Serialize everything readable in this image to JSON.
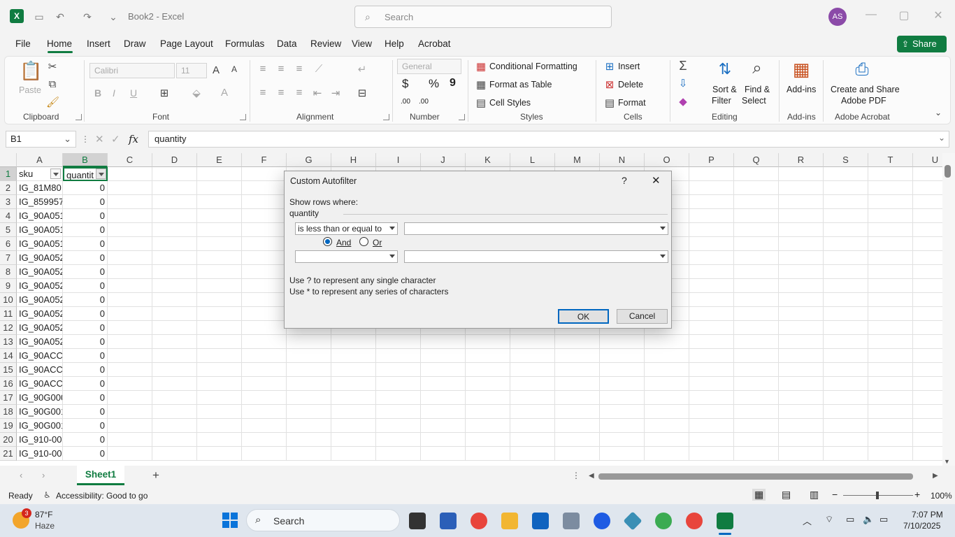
{
  "window": {
    "title": "Book2  -  Excel",
    "search_placeholder": "Search",
    "avatar_initials": "AS"
  },
  "menu": {
    "tabs": [
      "File",
      "Home",
      "Insert",
      "Draw",
      "Page Layout",
      "Formulas",
      "Data",
      "Review",
      "View",
      "Help",
      "Acrobat"
    ],
    "active": "Home",
    "share_label": "Share"
  },
  "ribbon": {
    "clipboard": {
      "paste": "Paste",
      "label": "Clipboard"
    },
    "font": {
      "name": "Calibri",
      "size": "11",
      "label": "Font",
      "bold": "B",
      "italic": "I",
      "underline": "U"
    },
    "alignment": {
      "label": "Alignment"
    },
    "number": {
      "format": "General",
      "label": "Number",
      "currency": "$",
      "percent": "%",
      "comma": "9",
      "inc_decimal": ".00",
      "dec_decimal": ".00"
    },
    "styles": {
      "conditional": "Conditional Formatting",
      "format_table": "Format as Table",
      "cell_styles": "Cell Styles",
      "label": "Styles"
    },
    "cells": {
      "insert": "Insert",
      "delete": "Delete",
      "format": "Format",
      "label": "Cells"
    },
    "editing": {
      "sort_filter_1": "Sort &",
      "sort_filter_2": "Filter",
      "find_select_1": "Find &",
      "find_select_2": "Select",
      "label": "Editing"
    },
    "addins": {
      "button": "Add-ins",
      "label": "Add-ins"
    },
    "acrobat": {
      "line1": "Create and Share",
      "line2": "Adobe PDF",
      "label": "Adobe Acrobat"
    }
  },
  "formula_bar": {
    "name_box": "B1",
    "fx": "fx",
    "content": "quantity"
  },
  "grid": {
    "columns": [
      "A",
      "B",
      "C",
      "D",
      "E",
      "F",
      "G",
      "H",
      "I",
      "J",
      "K",
      "L",
      "M",
      "N",
      "O",
      "P",
      "Q",
      "R",
      "S",
      "T",
      "U"
    ],
    "header_row": {
      "a": "sku",
      "b": "quantit"
    },
    "rows": [
      {
        "n": "2",
        "sku": "IG_81M80",
        "qty": "0"
      },
      {
        "n": "3",
        "sku": "IG_859957",
        "qty": "0"
      },
      {
        "n": "4",
        "sku": "IG_90A051",
        "qty": "0"
      },
      {
        "n": "5",
        "sku": "IG_90A051",
        "qty": "0"
      },
      {
        "n": "6",
        "sku": "IG_90A051",
        "qty": "0"
      },
      {
        "n": "7",
        "sku": "IG_90A052",
        "qty": "0"
      },
      {
        "n": "8",
        "sku": "IG_90A052",
        "qty": "0"
      },
      {
        "n": "9",
        "sku": "IG_90A052",
        "qty": "0"
      },
      {
        "n": "10",
        "sku": "IG_90A052",
        "qty": "0"
      },
      {
        "n": "11",
        "sku": "IG_90A052",
        "qty": "0"
      },
      {
        "n": "12",
        "sku": "IG_90A052",
        "qty": "0"
      },
      {
        "n": "13",
        "sku": "IG_90A052",
        "qty": "0"
      },
      {
        "n": "14",
        "sku": "IG_90ACC0",
        "qty": "0"
      },
      {
        "n": "15",
        "sku": "IG_90ACC",
        "qty": "0"
      },
      {
        "n": "16",
        "sku": "IG_90ACC",
        "qty": "0"
      },
      {
        "n": "17",
        "sku": "IG_90G000",
        "qty": "0"
      },
      {
        "n": "18",
        "sku": "IG_90G001",
        "qty": "0"
      },
      {
        "n": "19",
        "sku": "IG_90G001",
        "qty": "0"
      },
      {
        "n": "20",
        "sku": "IG_910-00",
        "qty": "0"
      },
      {
        "n": "21",
        "sku": "IG_910-00",
        "qty": "0"
      }
    ]
  },
  "sheets": {
    "active": "Sheet1",
    "add": "+"
  },
  "status": {
    "ready": "Ready",
    "accessibility": "Accessibility: Good to go",
    "zoom": "100%"
  },
  "taskbar": {
    "weather_temp": "87°F",
    "weather_desc": "Haze",
    "weather_badge": "3",
    "search": "Search",
    "time": "7:07 PM",
    "date": "7/10/2025"
  },
  "dialog": {
    "title": "Custom Autofilter",
    "help": "?",
    "close": "✕",
    "show_rows": "Show rows where:",
    "field": "quantity",
    "op1": "is less than or equal to",
    "val1": "",
    "and_label": "And",
    "or_label": "Or",
    "op2": "",
    "val2": "",
    "hint1": "Use ? to represent any single character",
    "hint2": "Use * to represent any series of characters",
    "ok": "OK",
    "cancel": "Cancel"
  }
}
